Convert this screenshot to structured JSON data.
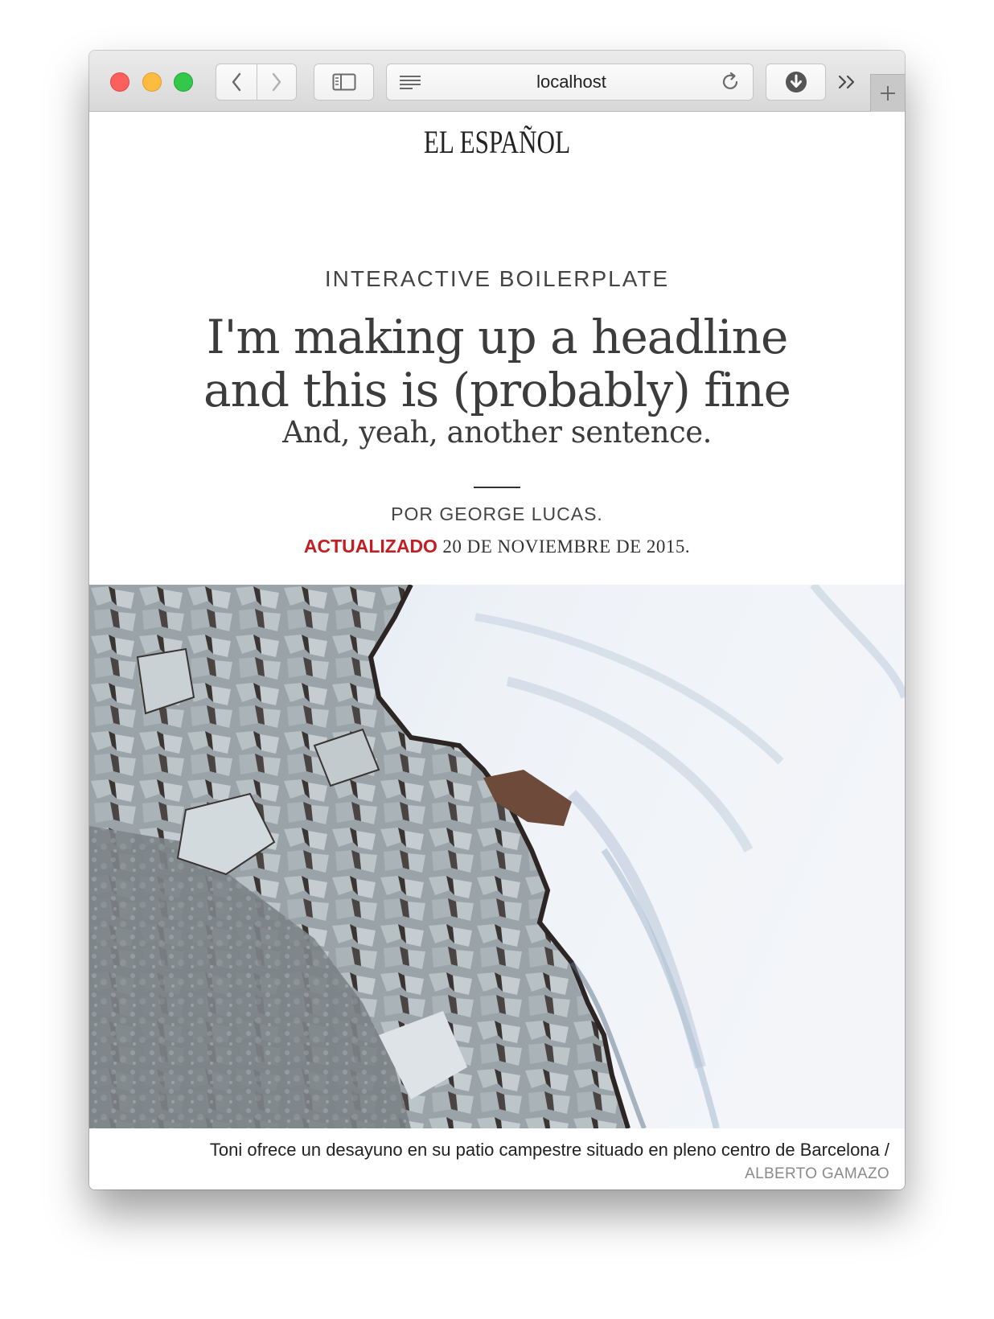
{
  "browser": {
    "url": "localhost",
    "icons": {
      "back": "chevron-left-icon",
      "forward": "chevron-right-icon",
      "sidebar": "sidebar-icon",
      "reader": "reader-lines-icon",
      "reload": "reload-icon",
      "download": "download-icon",
      "more": "double-chevron-right-icon",
      "new_tab": "plus-icon"
    }
  },
  "article": {
    "logo": "EL ESPAÑOL",
    "kicker": "INTERACTIVE BOILERPLATE",
    "headline_line1": "I'm making up a headline",
    "headline_line2": "and this is (probably) fine",
    "subhead": "And, yeah, another sentence.",
    "byline": "POR GEORGE LUCAS.",
    "updated_label": "ACTUALIZADO",
    "updated_date": "20 DE NOVIEMBRE DE 2015.",
    "image_alt": "Aerial satellite view of sea ice meeting a glacier",
    "caption": "Toni ofrece un desayuno en su patio campestre situado en pleno centro de Barcelona /",
    "credit": "ALBERTO GAMAZO"
  },
  "colors": {
    "accent_red": "#c41e22",
    "text_dark": "#3c3c3c"
  }
}
